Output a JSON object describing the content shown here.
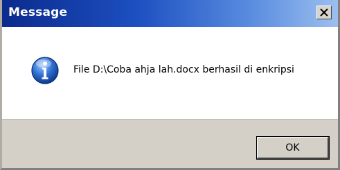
{
  "window": {
    "title": "Message"
  },
  "message": {
    "text": "File D:\\Coba ahja lah.docx berhasil di enkripsi",
    "icon": "info-icon"
  },
  "buttons": {
    "ok_label": "OK",
    "close_icon": "close-icon"
  },
  "colors": {
    "titlebar_start": "#0b2a8c",
    "titlebar_end": "#9ec0ef",
    "dialog_face": "#d4d0c8",
    "info_icon_blue": "#1f5fbf"
  }
}
